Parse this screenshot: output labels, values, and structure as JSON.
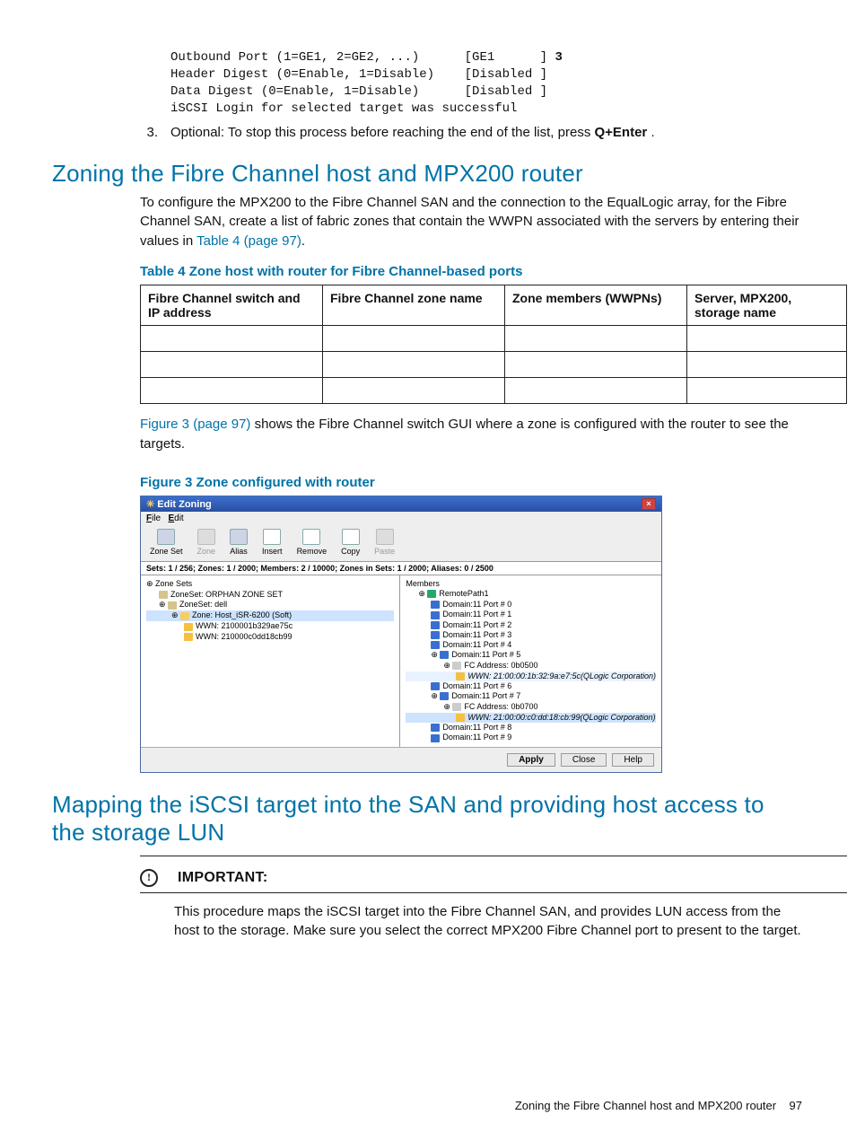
{
  "code": {
    "l1": "Outbound Port (1=GE1, 2=GE2, ...)      [GE1      ] ",
    "l1b": "3",
    "l2": "Header Digest (0=Enable, 1=Disable)    [Disabled ]",
    "l3": "Data Digest (0=Enable, 1=Disable)      [Disabled ]",
    "l4": "iSCSI Login for selected target was successful"
  },
  "step3": {
    "num": "3.",
    "text_a": "Optional: To stop this process before reaching the end of the list, press ",
    "key": "Q+Enter",
    "text_b": " ."
  },
  "h1_zoning": "Zoning the Fibre Channel host and MPX200 router",
  "para_zoning_a": "To configure the MPX200 to the Fibre Channel SAN and the connection to the EqualLogic array, for the Fibre Channel SAN, create a list of fabric zones that contain the WWPN associated with the servers by entering their values in ",
  "para_zoning_link": "Table 4 (page 97)",
  "para_zoning_b": ".",
  "table4_title": "Table 4 Zone host with router for Fibre Channel-based ports",
  "table4": {
    "h1": "Fibre Channel switch and IP address",
    "h2": "Fibre Channel zone name",
    "h3": "Zone members (WWPNs)",
    "h4": "Server, MPX200, storage name"
  },
  "para_fig_a": "",
  "para_fig_link": "Figure 3 (page 97)",
  "para_fig_b": " shows the Fibre Channel switch GUI where a zone is configured with the router to see the targets.",
  "fig3_title": "Figure 3 Zone configured with router",
  "shot": {
    "title": "Edit Zoning",
    "menu_file": "File",
    "menu_edit": "Edit",
    "tools": [
      "Zone Set",
      "Zone",
      "Alias",
      "Insert",
      "Remove",
      "Copy",
      "Paste"
    ],
    "status": "Sets: 1 / 256;  Zones: 1 / 2000;  Members: 2 / 10000;  Zones in Sets: 1 / 2000;  Aliases: 0 / 2500",
    "left": {
      "root": "Zone Sets",
      "orphan": "ZoneSet: ORPHAN ZONE SET",
      "dell": "ZoneSet: dell",
      "zone": "Zone: Host_iSR-6200 (Soft)",
      "w1": "WWN: 2100001b329ae75c",
      "w2": "WWN: 210000c0dd18cb99"
    },
    "right": {
      "root": "Members",
      "remote": "RemotePath1",
      "ports": [
        "Domain:11 Port # 0",
        "Domain:11 Port # 1",
        "Domain:11 Port # 2",
        "Domain:11 Port # 3",
        "Domain:11 Port # 4",
        "Domain:11 Port # 5"
      ],
      "fc1": "FC Address: 0b0500",
      "wwn1": "WWN: 21:00:00:1b:32:9a:e7:5c(QLogic Corporation)",
      "p6": "Domain:11 Port # 6",
      "p7": "Domain:11 Port # 7",
      "fc2": "FC Address: 0b0700",
      "wwn2": "WWN: 21:00:00:c0:dd:18:cb:99(QLogic Corporation)",
      "p8": "Domain:11 Port # 8",
      "p9": "Domain:11 Port # 9"
    },
    "btn_apply": "Apply",
    "btn_close": "Close",
    "btn_help": "Help"
  },
  "h1_mapping": "Mapping the iSCSI target into the SAN and providing host access to the storage LUN",
  "important_label": "IMPORTANT:",
  "important_text": "This procedure maps the iSCSI target into the Fibre Channel SAN, and provides LUN access from the host to the storage. Make sure you select the correct MPX200 Fibre Channel port to present to the target.",
  "footer_text": "Zoning the Fibre Channel host and MPX200 router",
  "footer_page": "97"
}
